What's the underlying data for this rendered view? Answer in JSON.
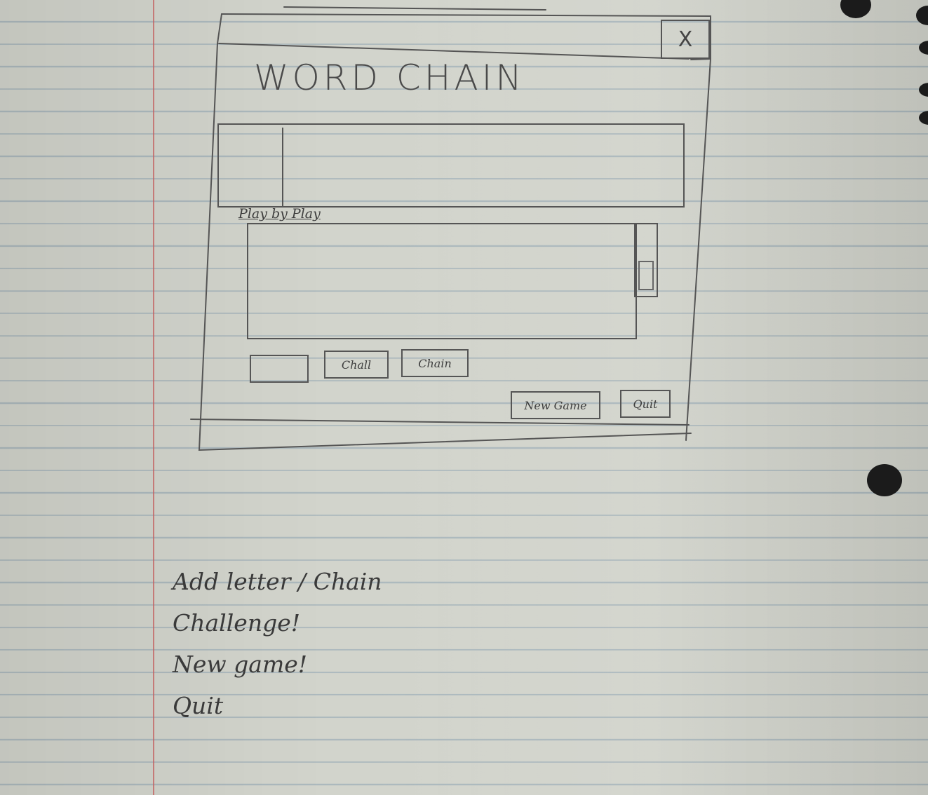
{
  "window": {
    "title": "WORD CHAIN",
    "close_label": "X"
  },
  "chain_area": {
    "value": ""
  },
  "play_by_play": {
    "label": "Play by Play"
  },
  "controls": {
    "letter_value": "",
    "challenge_label": "Chall",
    "chain_label": "Chain"
  },
  "footer": {
    "new_game_label": "New Game",
    "quit_label": "Quit"
  },
  "notes": [
    "Add letter / Chain",
    "Challenge!",
    "New game!",
    "Quit"
  ]
}
